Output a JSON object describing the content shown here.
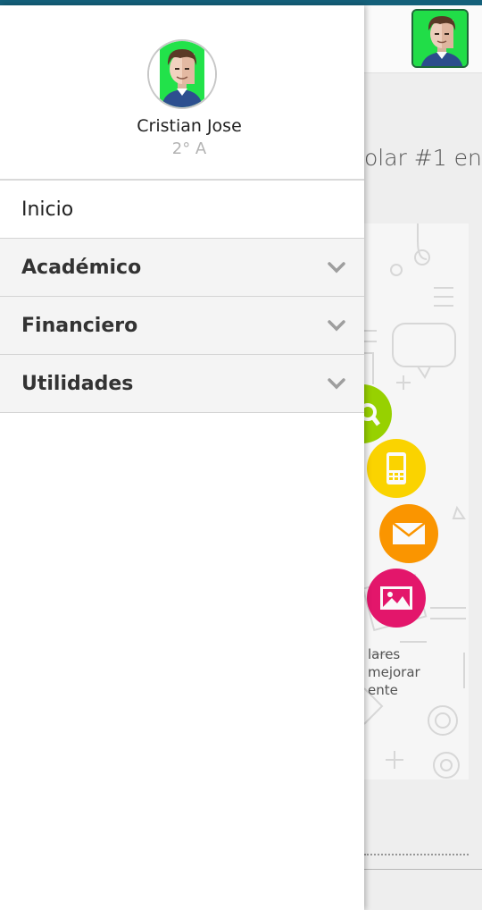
{
  "background": {
    "headline": "olar #1 en",
    "promo_text": [
      "lares",
      "mejorar",
      "ente"
    ],
    "colors": {
      "status_bar": "#14607a",
      "green": "#9bd600",
      "yellow": "#ffd800",
      "orange": "#ff9800",
      "pink": "#e8176e"
    }
  },
  "drawer": {
    "user": {
      "name": "Cristian Jose",
      "grade": "2° A",
      "avatar": "student-avatar"
    },
    "menu": [
      {
        "label": "Inicio",
        "expandable": false
      },
      {
        "label": "Académico",
        "expandable": true,
        "icon": "chevron-down-icon"
      },
      {
        "label": "Financiero",
        "expandable": true,
        "icon": "chevron-down-icon"
      },
      {
        "label": "Utilidades",
        "expandable": true,
        "icon": "chevron-down-icon"
      }
    ]
  }
}
